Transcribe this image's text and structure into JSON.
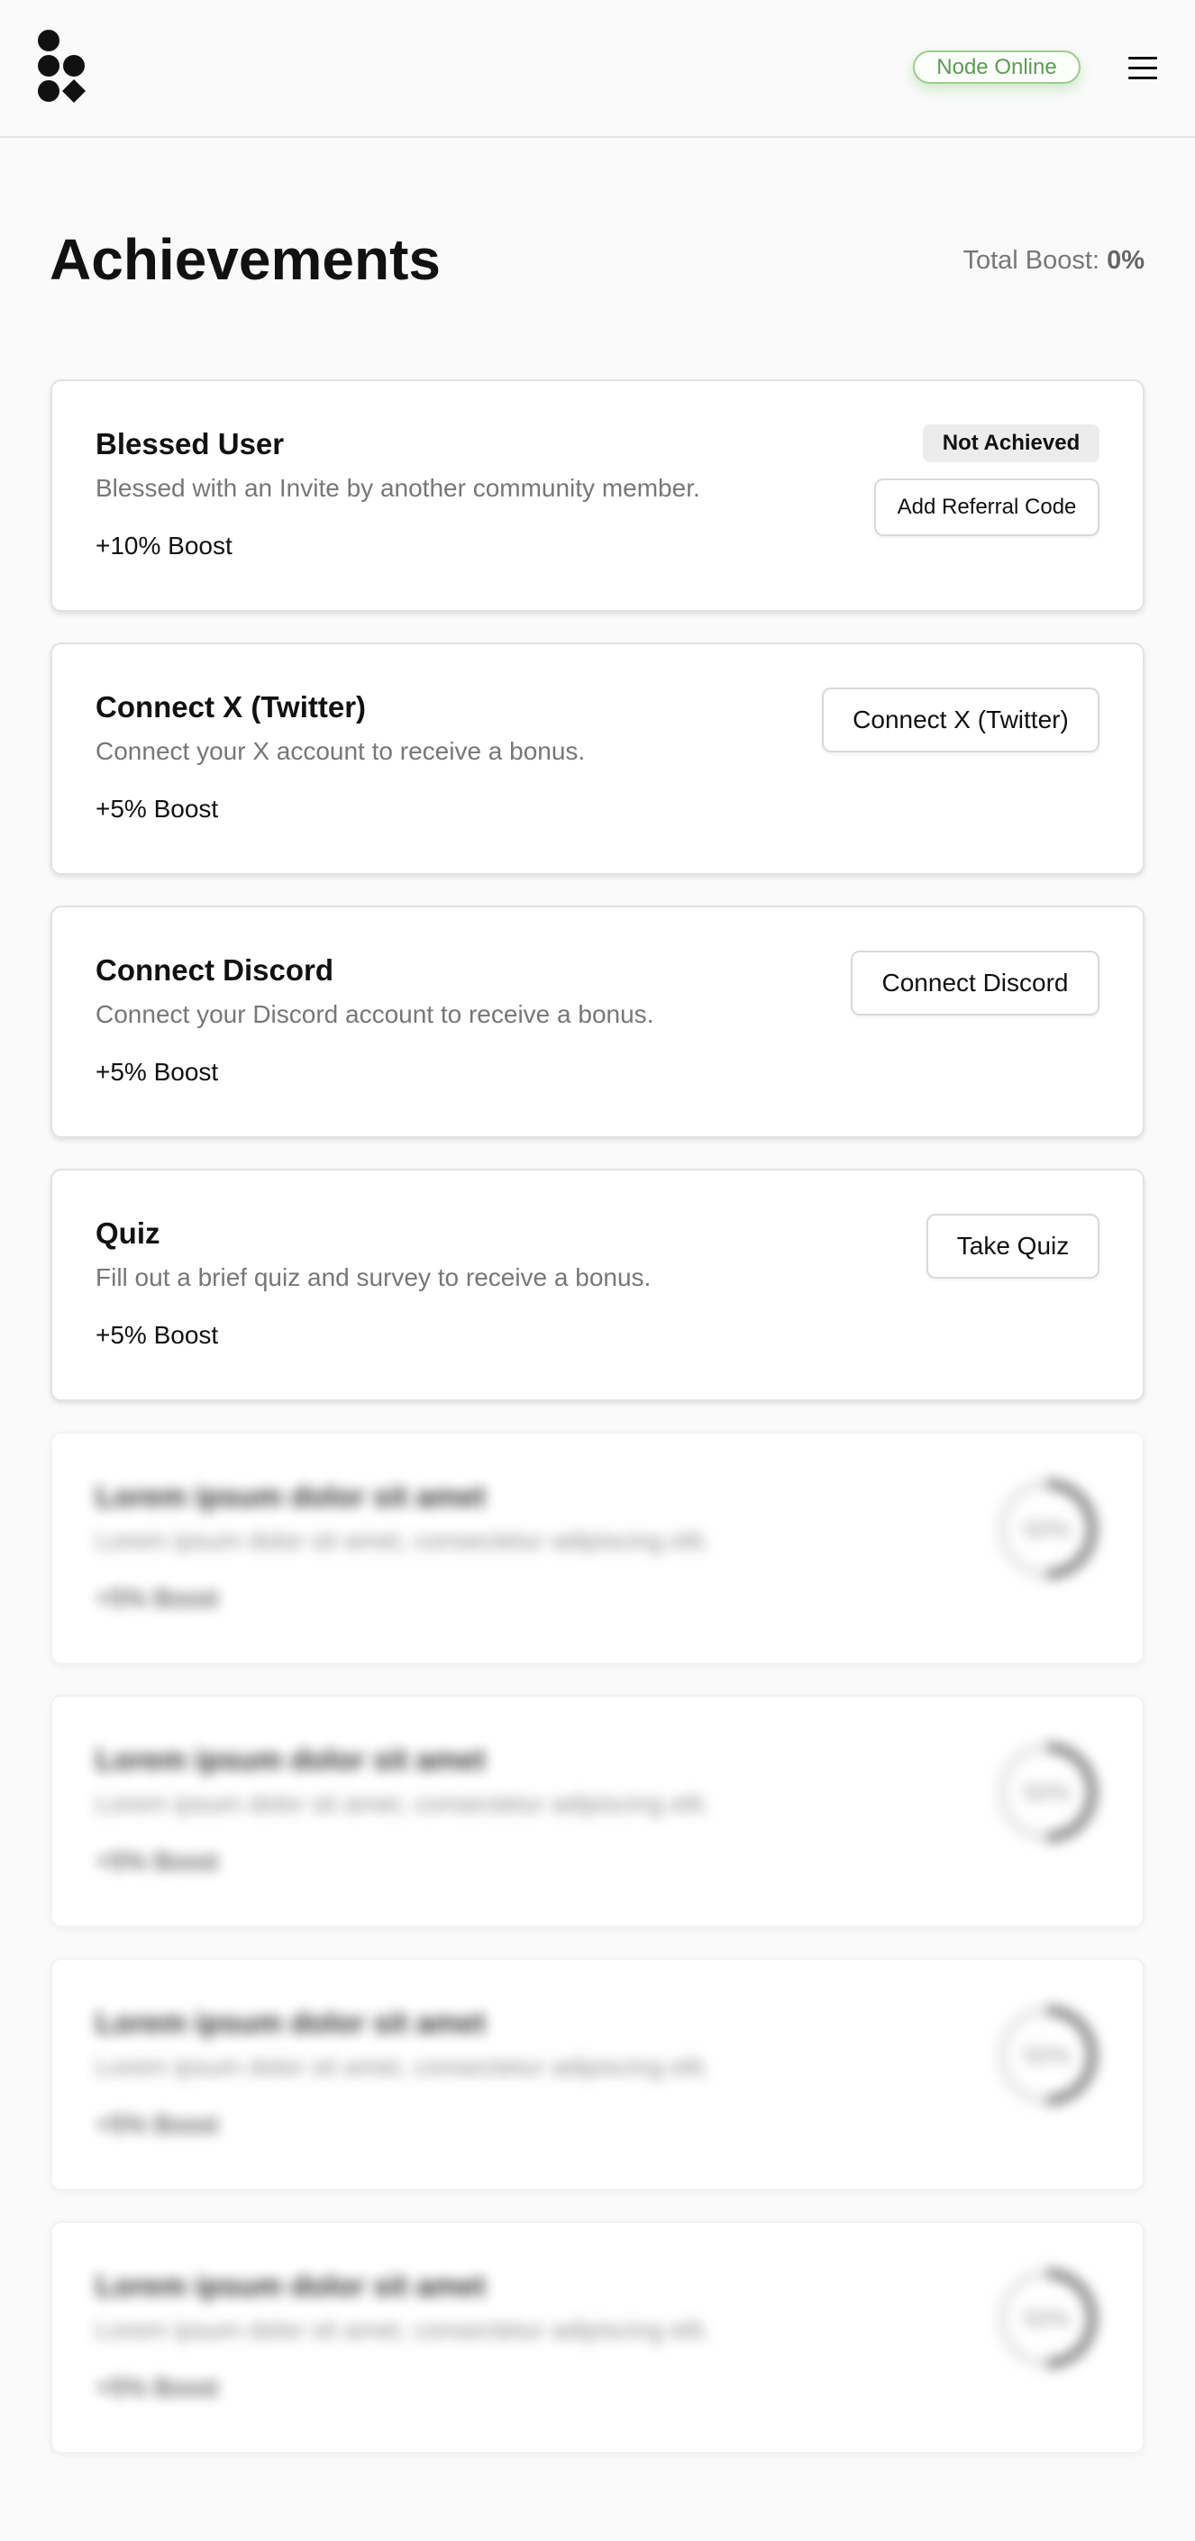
{
  "header": {
    "logo_icon": "logo-shapes-icon",
    "status": "Node Online",
    "status_color": "#5d9a52",
    "menu_icon": "hamburger-menu-icon"
  },
  "page": {
    "title": "Achievements",
    "total_boost_label": "Total Boost:",
    "total_boost_value": "0%"
  },
  "achievements": [
    {
      "title": "Blessed User",
      "description": "Blessed with an Invite by another community member.",
      "boost": "+10% Boost",
      "badge": "Not Achieved",
      "action": "Add Referral Code"
    },
    {
      "title": "Connect X (Twitter)",
      "description": "Connect your X account to receive a bonus.",
      "boost": "+5% Boost",
      "action": "Connect X (Twitter)"
    },
    {
      "title": "Connect Discord",
      "description": "Connect your Discord account to receive a bonus.",
      "boost": "+5% Boost",
      "action": "Connect Discord"
    },
    {
      "title": "Quiz",
      "description": "Fill out a brief quiz and survey to receive a bonus.",
      "boost": "+5% Boost",
      "action": "Take Quiz"
    }
  ],
  "locked_achievements": [
    {
      "title": "Lorem ipsum dolor sit amet",
      "description": "Lorem ipsum dolor sit amet, consectetur adipiscing elit.",
      "boost": "+5% Boost",
      "progress": "50%"
    },
    {
      "title": "Lorem ipsum dolor sit amet",
      "description": "Lorem ipsum dolor sit amet, consectetur adipiscing elit.",
      "boost": "+5% Boost",
      "progress": "50%"
    },
    {
      "title": "Lorem ipsum dolor sit amet",
      "description": "Lorem ipsum dolor sit amet, consectetur adipiscing elit.",
      "boost": "+5% Boost",
      "progress": "50%"
    },
    {
      "title": "Lorem ipsum dolor sit amet",
      "description": "Lorem ipsum dolor sit amet, consectetur adipiscing elit.",
      "boost": "+5% Boost",
      "progress": "50%"
    }
  ]
}
